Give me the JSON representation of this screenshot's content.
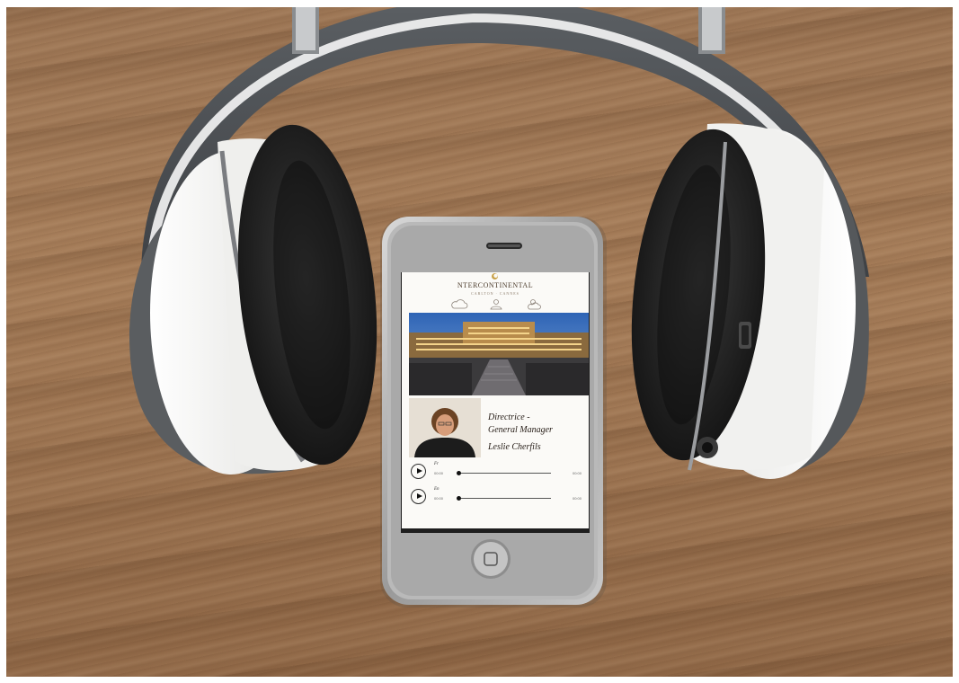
{
  "app": {
    "brand_name": "NTERCONTINENTAL",
    "brand_subtitle": "CARLTON · CANNES"
  },
  "nav": {
    "items": [
      {
        "icon": "cloud-icon"
      },
      {
        "icon": "person-icon"
      },
      {
        "icon": "sun-cloud-icon"
      }
    ]
  },
  "profile": {
    "title_line1": "Directrice -",
    "title_line2": "General Manager",
    "name": "Leslie Cherfils"
  },
  "tracks": [
    {
      "language": "Fr",
      "time_start": "00:00",
      "time_end": "00:00",
      "progress": 0.0
    },
    {
      "language": "En",
      "time_start": "00:00",
      "time_end": "00:00",
      "progress": 0.0
    }
  ],
  "colors": {
    "wood": "#9a7352",
    "headphone_white": "#f4f4f2",
    "headphone_black": "#1c1c1c",
    "screen_bg": "#fbfaf7",
    "hero_sky": "#3d78c4"
  }
}
